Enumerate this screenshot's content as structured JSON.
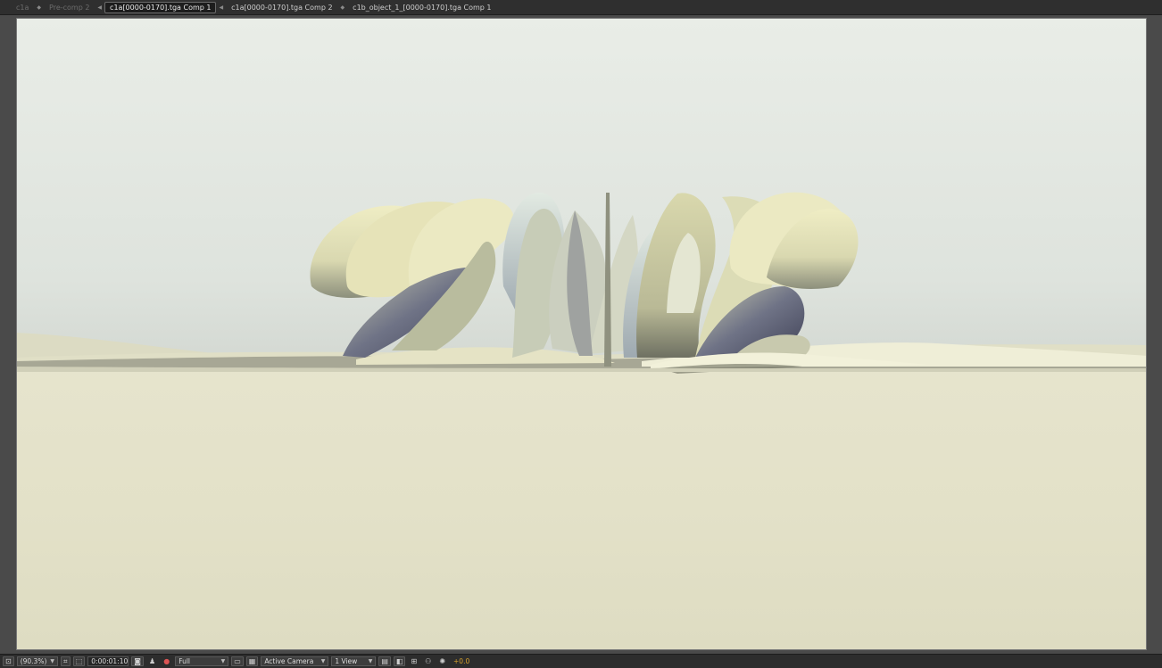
{
  "tabs": [
    {
      "label": "c1a",
      "state": "dim"
    },
    {
      "label": "Pre-comp 2",
      "state": "dim"
    },
    {
      "label": "c1a[0000-0170].tga Comp 1",
      "state": "active"
    },
    {
      "label": "c1a[0000-0170].tga Comp 2",
      "state": "normal"
    },
    {
      "label": "c1b_object_1_[0000-0170].tga Comp 1",
      "state": "normal"
    }
  ],
  "toolbar": {
    "magnification": "(90.3%)",
    "timecode": "0:00:01:10",
    "resolution": "Full",
    "camera": "Active Camera",
    "views": "1 View",
    "exposure": "+0.0"
  },
  "icons": {
    "viewer_options": "viewer-options-icon",
    "safe_zones": "safe-zones-icon",
    "region": "region-of-interest-icon",
    "snapshot": "camera-snapshot-icon",
    "show_snapshot": "show-snapshot-icon",
    "channel": "color-channel-icon",
    "transparency": "transparency-grid-icon",
    "fast_preview": "fast-previews-icon",
    "timeline": "timeline-icon",
    "flowchart": "comp-flowchart-icon",
    "exposure_reset": "reset-exposure-icon"
  },
  "colors": {
    "sky_top": "#e8ece6",
    "sky_horizon": "#d7dcd6",
    "ground": "#e2e0c6",
    "accent_exposure": "#d8a12c"
  }
}
